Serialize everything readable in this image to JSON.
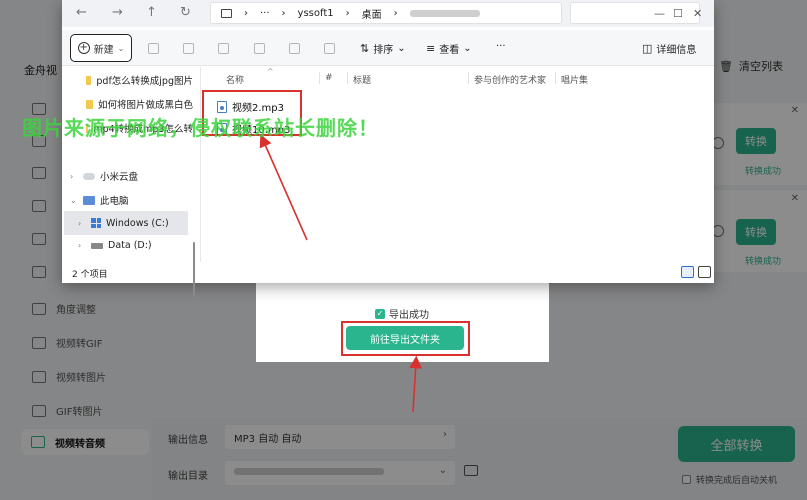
{
  "app": {
    "title_fragment": "金舟视",
    "clear_list": "清空列表",
    "sidebar": [
      {
        "label": "角度调整",
        "icon": "rotate-icon"
      },
      {
        "label": "视频转GIF",
        "icon": "gif-icon"
      },
      {
        "label": "视频转图片",
        "icon": "image-icon"
      },
      {
        "label": "GIF转图片",
        "icon": "gif-image-icon"
      },
      {
        "label": "视频转音频",
        "icon": "audio-icon",
        "active": true
      }
    ],
    "rows": [
      {
        "button": "转换",
        "status": "转换成功"
      },
      {
        "button": "转换",
        "status": "转换成功"
      }
    ],
    "output_info_label": "输出信息",
    "output_info_value": "MP3  自动  自动",
    "output_dir_label": "输出目录",
    "convert_all": "全部转换",
    "auto_shutdown": "转换完成后自动关机",
    "accent": "#2bb58f"
  },
  "dialog": {
    "export_ok": "导出成功",
    "open_folder": "前往导出文件夹"
  },
  "explorer": {
    "breadcrumb": [
      "yssoft1",
      "桌面"
    ],
    "toolbar": {
      "new_label": "新建",
      "sort_label": "排序",
      "view_label": "查看",
      "more_label": "···",
      "details_label": "详细信息"
    },
    "tree": [
      {
        "label": "pdf怎么转换成jpg图片",
        "kind": "folder"
      },
      {
        "label": "如何将图片做成黑白色",
        "kind": "folder"
      },
      {
        "label": "mp4转换成mp3怎么转",
        "kind": "folder"
      },
      {
        "label": "小米云盘",
        "kind": "cloud"
      },
      {
        "label": "此电脑",
        "kind": "pc"
      },
      {
        "label": "Windows (C:)",
        "kind": "system-drive"
      },
      {
        "label": "Data (D:)",
        "kind": "drive"
      }
    ],
    "columns": [
      "名称",
      "#",
      "标题",
      "参与创作的艺术家",
      "唱片集"
    ],
    "files": [
      "视频2.mp3",
      "视频10.mp3"
    ],
    "status": "2 个项目"
  },
  "watermark": "图片来源于网络，侵权联系站长删除！"
}
